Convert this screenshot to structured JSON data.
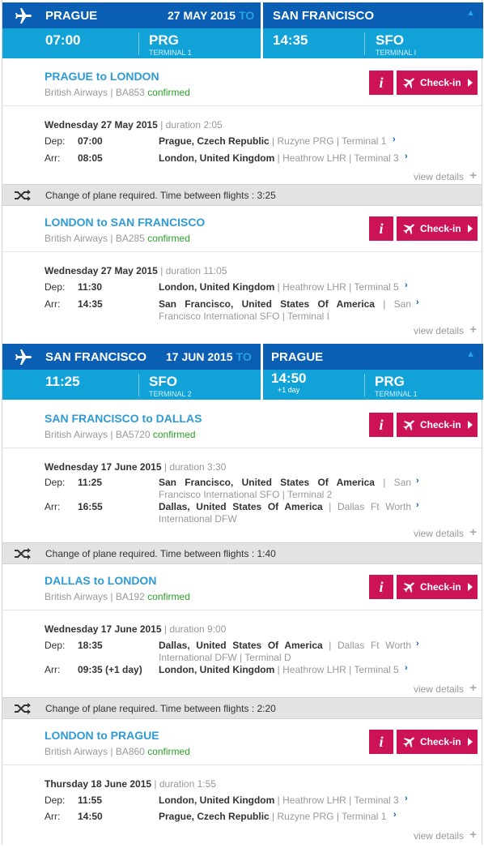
{
  "trips": [
    {
      "from_city": "PRAGUE",
      "date": "27 MAY 2015",
      "to_word": "TO",
      "to_city": "SAN FRANCISCO",
      "dep_time": "07:00",
      "dep_code": "PRG",
      "dep_terminal": "TERMINAL 1",
      "arr_time": "14:35",
      "arr_sub": "",
      "arr_code": "SFO",
      "arr_terminal": "TERMINAL I"
    },
    {
      "from_city": "SAN FRANCISCO",
      "date": "17 JUN 2015",
      "to_word": "TO",
      "to_city": "PRAGUE",
      "dep_time": "11:25",
      "dep_code": "SFO",
      "dep_terminal": "TERMINAL 2",
      "arr_time": "14:50",
      "arr_sub": "+1 day",
      "arr_code": "PRG",
      "arr_terminal": "TERMINAL 1"
    }
  ],
  "buttons": {
    "info": "i",
    "checkin": "Check-in"
  },
  "labels": {
    "dep": "Dep:",
    "arr": "Arr:",
    "view_details": "view details"
  },
  "segments": [
    {
      "route": "PRAGUE to LONDON",
      "airline": "British Airways |",
      "flight": "BA853",
      "status": "confirmed",
      "date": "Wednesday 27 May 2015",
      "duration": "| duration 2:05",
      "dep_time": "07:00",
      "dep_place": "Prague, Czech Republic",
      "dep_airport": "| Ruzyne PRG | Terminal 1",
      "arr_time": "08:05",
      "arr_place": "London, United Kingdom",
      "arr_airport": "| Heathrow LHR | Terminal 3"
    },
    {
      "route": "LONDON to SAN FRANCISCO",
      "airline": "British Airways |",
      "flight": "BA285",
      "status": "confirmed",
      "date": "Wednesday 27 May 2015",
      "duration": "| duration 11:05",
      "dep_time": "11:30",
      "dep_place": "London, United Kingdom",
      "dep_airport": "| Heathrow LHR | Terminal 5",
      "arr_time": "14:35",
      "arr_place": "San Francisco, United States Of America",
      "arr_airport": "| San Francisco International SFO | Terminal I"
    },
    {
      "route": "SAN FRANCISCO to DALLAS",
      "airline": "British Airways |",
      "flight": "BA5720",
      "status": "confirmed",
      "date": "Wednesday 17 June 2015",
      "duration": "| duration 3:30",
      "dep_time": "11:25",
      "dep_place": "San Francisco, United States Of America",
      "dep_airport": "| San Francisco International SFO | Terminal 2",
      "arr_time": "16:55",
      "arr_place": "Dallas, United States Of America",
      "arr_airport": "| Dallas Ft Worth International DFW"
    },
    {
      "route": "DALLAS to LONDON",
      "airline": "British Airways |",
      "flight": "BA192",
      "status": "confirmed",
      "date": "Wednesday 17 June 2015",
      "duration": "| duration 9:00",
      "dep_time": "18:35",
      "dep_place": "Dallas, United States Of America",
      "dep_airport": "| Dallas Ft Worth International DFW | Terminal D",
      "arr_time": "09:35 (+1 day)",
      "arr_place": "London, United Kingdom",
      "arr_airport": "| Heathrow LHR | Terminal 5"
    },
    {
      "route": "LONDON to PRAGUE",
      "airline": "British Airways |",
      "flight": "BA860",
      "status": "confirmed",
      "date": "Thursday 18 June 2015",
      "duration": "| duration 1:55",
      "dep_time": "11:55",
      "dep_place": "London, United Kingdom",
      "dep_airport": "| Heathrow LHR | Terminal 3",
      "arr_time": "14:50",
      "arr_place": "Prague, Czech Republic",
      "arr_airport": "| Ruzyne PRG | Terminal 1"
    }
  ],
  "changes": [
    "Change of plane required. Time between flights : 3:25",
    "Change of plane required. Time between flights : 1:40",
    "Change of plane required. Time between flights : 2:20"
  ],
  "colors": {
    "header_dark": "#0a5eb3",
    "header_light": "#11a3d8",
    "route_blue": "#2d9bd6",
    "button_pink": "#cc1357",
    "confirmed_green": "#2aa12a"
  }
}
